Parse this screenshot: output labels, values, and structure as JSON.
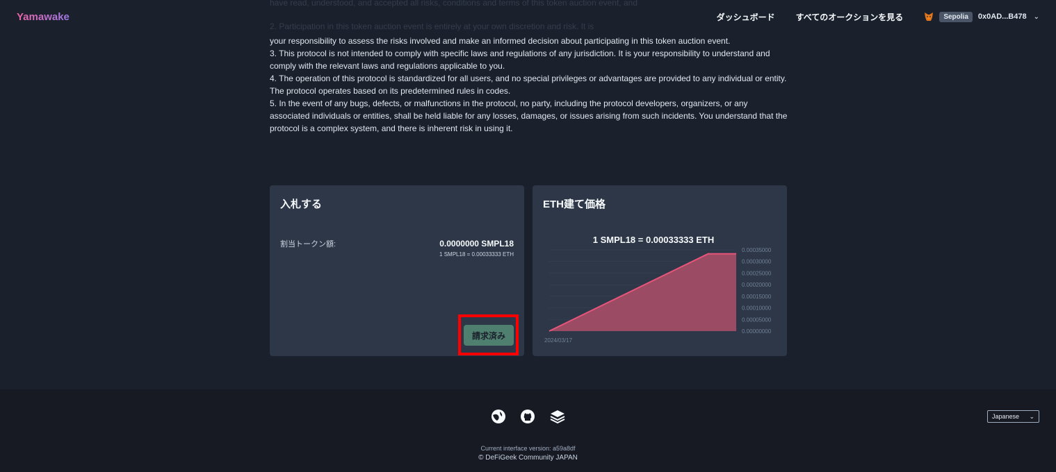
{
  "header": {
    "logo": "Yamawake",
    "nav_dashboard": "ダッシュボード",
    "nav_all_auctions": "すべてのオークションを見る",
    "network": "Sepolia",
    "address": "0x0AD...B478"
  },
  "terms": {
    "faded_line1": "have read, understood, and accepted all risks, conditions and terms of this token auction event, and",
    "faded_line2": "2. Participation in this token auction event is entirely at your own discretion and risk. It is",
    "item2_tail": "your responsibility to assess the risks involved and make an informed decision about participating in this token auction event.",
    "item3": "3. This protocol is not intended to comply with specific laws and regulations of any jurisdiction. It is your responsibility to understand and comply with the relevant laws and regulations applicable to you.",
    "item4": "4. The operation of this protocol is standardized for all users, and no special privileges or advantages are provided to any individual or entity. The protocol operates based on its predetermined rules in codes.",
    "item5": "5. In the event of any bugs, defects, or malfunctions in the protocol, no party, including the protocol developers, organizers, or any associated individuals or entities, shall be held liable for any losses, damages, or issues arising from such incidents. You understand that the protocol is a complex system, and there is inherent risk in using it."
  },
  "bid_card": {
    "title": "入札する",
    "allocation_label": "割当トークン額:",
    "allocation_amount": "0.0000000 SMPL18",
    "rate": "1 SMPL18 = 0.00033333 ETH",
    "claimed_button": "請求済み"
  },
  "price_card": {
    "title": "ETH建て価格",
    "current_price": "1 SMPL18 = 0.00033333 ETH"
  },
  "chart_data": {
    "type": "area",
    "x_label_visible": "2024/03/17",
    "y_ticks": [
      "0.00035000",
      "0.00030000",
      "0.00025000",
      "0.00020000",
      "0.00015000",
      "0.00010000",
      "0.00005000",
      "0.00000000"
    ],
    "ylim": [
      0,
      0.00035
    ],
    "points": [
      [
        0,
        0.0
      ],
      [
        0.85,
        0.00033333
      ],
      [
        1.0,
        0.00033333
      ]
    ],
    "line_color": "#e8557a",
    "fill_color": "#9b4b63"
  },
  "footer": {
    "version": "Current interface version: a59a8df",
    "copyright": "© DeFiGeek Community JAPAN",
    "language": "Japanese",
    "icons": [
      "defigeek-icon",
      "github-icon",
      "docs-stack-icon"
    ]
  }
}
